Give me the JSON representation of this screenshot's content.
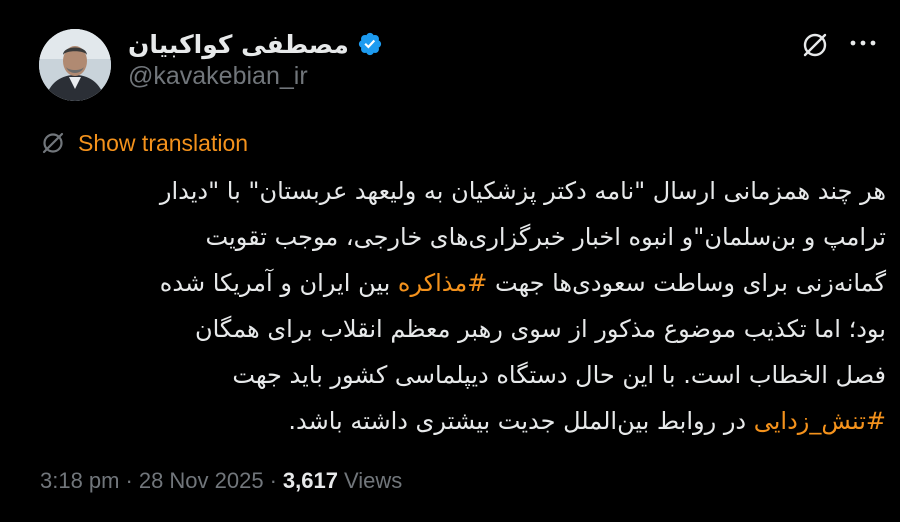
{
  "author": {
    "display_name": "مصطفی کواکبیان",
    "handle": "@kavakebian_ir",
    "verified": true
  },
  "actions": {
    "grok_icon": "grok-icon",
    "more_icon": "more-icon"
  },
  "translation": {
    "label": "Show translation",
    "icon": "translate-icon"
  },
  "body": {
    "line1": "هر چند همزمانی ارسال \"نامه دکتر پزشکیان به ولیعهد عربستان\" با \"دیدار",
    "line2": "ترامپ و بن‌سلمان\"و انبوه اخبار خبرگزاری‌های خارجی، موجب تقویت",
    "line3_before": "گمانه‌زنی برای وساطت سعودی‌ها جهت ",
    "hashtag1": "#مذاکره",
    "line3_after": " بین ایران و آمریکا شده",
    "line4": "بود؛ اما تکذیب موضوع مذکور از سوی رهبر معظم انقلاب برای همگان",
    "line5": "فصل الخطاب است. با این حال دستگاه دیپلماسی کشور باید جهت",
    "hashtag2": "#تنش_زدایی",
    "line6_after": " در روابط بین‌الملل جدیت بیشتری داشته باشد."
  },
  "meta": {
    "time": "3:18 pm",
    "separator": "·",
    "date": "28 Nov 2025",
    "views_count": "3,617",
    "views_label": "Views"
  },
  "colors": {
    "background": "#000000",
    "text": "#e7e9ea",
    "muted": "#71767b",
    "accent": "#f4921c",
    "verified": "#1d9bf0"
  }
}
